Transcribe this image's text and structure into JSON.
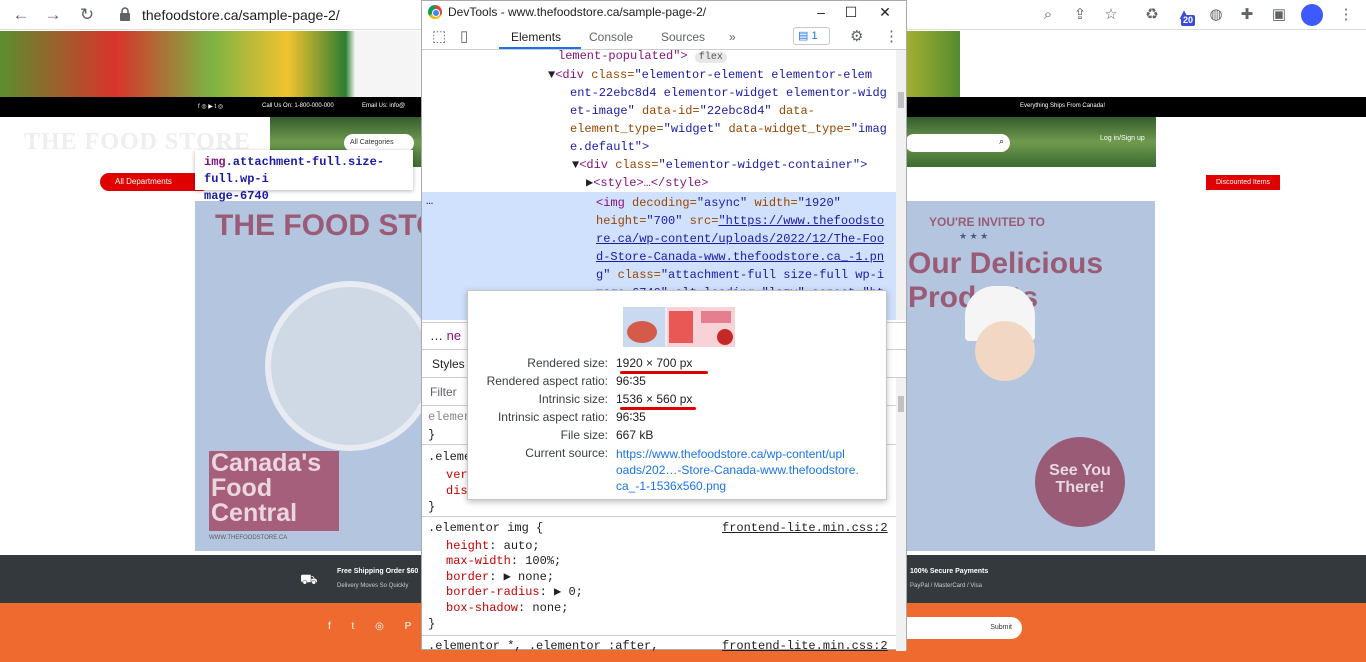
{
  "browser": {
    "url": "thefoodstore.ca/sample-page-2/",
    "extension_badge": "20"
  },
  "site": {
    "topbar": {
      "phone": "Call Us On: 1-800-000-000",
      "email": "Email Us: info@",
      "shipping": "Everything Ships From Canada!"
    },
    "logo": "THE FOOD STORE",
    "categories_label": "All Categories",
    "login_label": "Log in/Sign up",
    "all_departments": "All Departments",
    "discounted_items": "Discounted Items",
    "hero": {
      "title_left": "THE FOOD STO",
      "canada_lines": [
        "Canada's",
        "Food",
        "Central"
      ],
      "url": "WWW.THEFOODSTORE.CA",
      "invited": "YOU'RE INVITED TO",
      "stars": "★ ★ ★",
      "delicious_lines": [
        "Our Delicious",
        "Products"
      ],
      "see_you_lines": [
        "See You",
        "There!"
      ]
    },
    "features": {
      "shipping_title": "Free Shipping Order $60",
      "shipping_sub": "Delivery Moves So Quickly",
      "payments_title": "100% Secure Payments",
      "payments_sub": "PayPal / MasterCard / Visa"
    },
    "footer": {
      "social": "f t ◎ P ▶",
      "submit": "Submit"
    },
    "element_tooltip": {
      "tag": "img",
      "classes": ".attachment-full.size-full.wp-i",
      "classes2": "mage-6740"
    }
  },
  "devtools": {
    "title": "DevTools - www.thefoodstore.ca/sample-page-2/",
    "tabs": [
      "Elements",
      "Console",
      "Sources",
      "»"
    ],
    "issues_count": "1",
    "dom_lines": {
      "l0": "lement-populated\">",
      "l0_badge": "flex",
      "l1a": "<div ",
      "l1b": "class=",
      "l1c": "\"elementor-element elementor-elem",
      "l2": "ent-22ebc8d4 elementor-widget elementor-widg",
      "l3a": "et-image\" ",
      "l3b": "data-id=",
      "l3c": "\"22ebc8d4\" ",
      "l3d": "data-",
      "l4a": "element_type=",
      "l4b": "\"widget\" ",
      "l4c": "data-widget_type=",
      "l4d": "\"imag",
      "l5": "e.default\">",
      "l6a": "<div ",
      "l6b": "class=",
      "l6c": "\"elementor-widget-container\">",
      "l7": "<style>…</style>",
      "l8a": "<img ",
      "l8b": "decoding=",
      "l8c": "\"async\" ",
      "l8d": "width=",
      "l8e": "\"1920\"",
      "l9a": "height=",
      "l9b": "\"700\" ",
      "l9c": "src=",
      "l9d": "\"https://www.thefoodsto",
      "l10": "re.ca/wp-content/uploads/2022/12/The-Foo",
      "l11": "d-Store-Canada-www.thefoodstore.ca_-1.pn",
      "l12a": "g\" ",
      "l12b": "class=",
      "l12c": "\"attachment-full size-full wp-i",
      "l13": "mage-6740\" alt loading=\"lazy\" aspect=\"ht"
    },
    "dots": "…",
    "crumb_prefix": "…",
    "crumb_text": "ne",
    "styles_tab": "Styles",
    "filter_placeholder": "Filter",
    "styles": {
      "s0": "elemen",
      "s1": "}",
      "s2": ".eleme",
      "s3a": "ver",
      "s3b": "dis",
      "s4": "}",
      "rule_selector": ".elementor img {",
      "rule_source": "frontend-lite.min.css:2",
      "props": [
        {
          "name": "height",
          "value": "auto;"
        },
        {
          "name": "max-width",
          "value": "100%;"
        },
        {
          "name": "border",
          "value": "▶ none;"
        },
        {
          "name": "border-radius",
          "value": "▶ 0;"
        },
        {
          "name": "box-shadow",
          "value": "none;"
        }
      ],
      "close": "}",
      "next_selector": ".elementor *, .elementor :after,",
      "next_source": "frontend-lite.min.css:2"
    },
    "popup": {
      "rendered_size_label": "Rendered size:",
      "rendered_size": "1920 × 700 px",
      "rendered_aspect_label": "Rendered aspect ratio:",
      "rendered_aspect": "96∶35",
      "intrinsic_size_label": "Intrinsic size:",
      "intrinsic_size": "1536 × 560 px",
      "intrinsic_aspect_label": "Intrinsic aspect ratio:",
      "intrinsic_aspect": "96∶35",
      "file_size_label": "File size:",
      "file_size": "667 kB",
      "current_source_label": "Current source:",
      "current_source_lines": [
        "https://www.thefoodstore.ca/wp-content/upl",
        "oads/202…-Store-Canada-www.thefoodstore.",
        "ca_-1-1536x560.png"
      ]
    }
  }
}
